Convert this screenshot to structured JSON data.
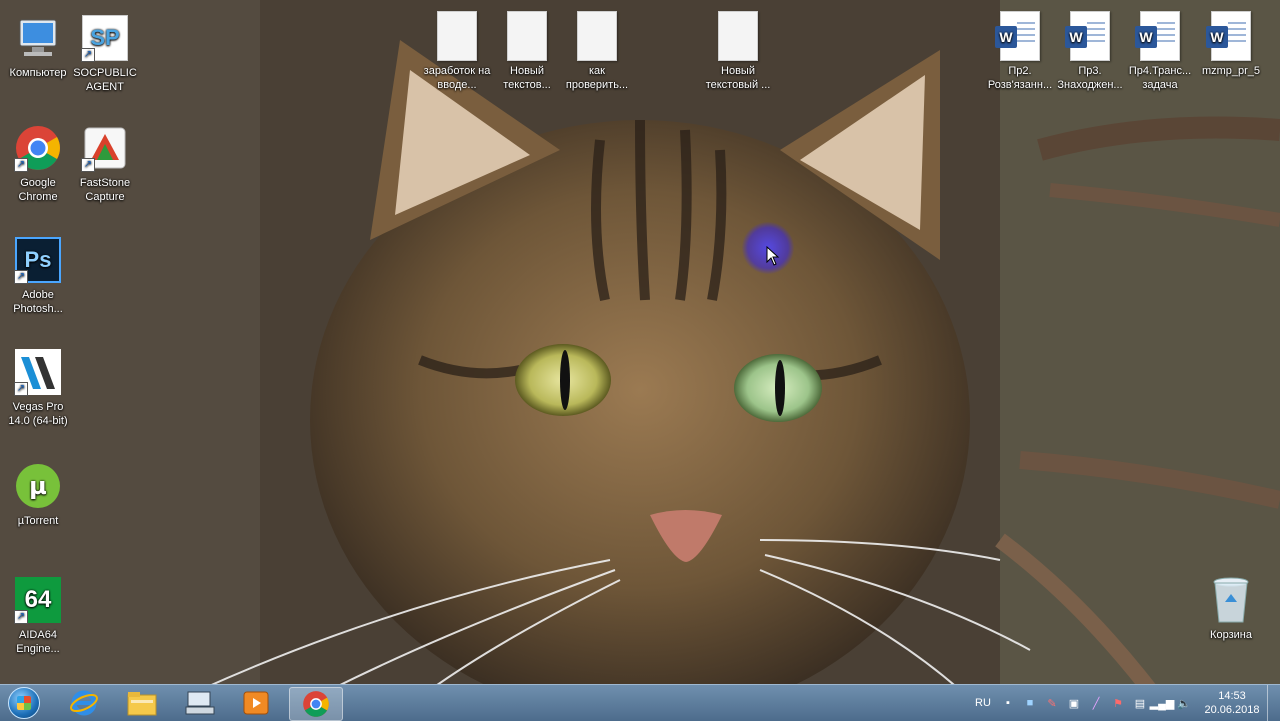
{
  "desktop": {
    "left_icons": [
      {
        "label": "Компьютер",
        "icon": "computer-icon"
      },
      {
        "label": "SOCPUBLIC AGENT",
        "icon": "socpublic-icon"
      },
      {
        "label": "Google Chrome",
        "icon": "chrome-icon"
      },
      {
        "label": "FastStone Capture",
        "icon": "faststone-icon"
      },
      {
        "label": "Adobe Photosh...",
        "icon": "photoshop-icon"
      },
      {
        "label": "Vegas Pro 14.0 (64-bit)",
        "icon": "vegas-icon"
      },
      {
        "label": "µTorrent",
        "icon": "utorrent-icon"
      },
      {
        "label": "AIDA64 Engine...",
        "icon": "aida64-icon"
      }
    ],
    "top_files": [
      {
        "label": "заработок на вводе...",
        "icon": "text-file-icon"
      },
      {
        "label": "Новый текстов...",
        "icon": "text-file-icon"
      },
      {
        "label": "как проверить...",
        "icon": "text-file-icon"
      },
      {
        "label": "Новый текстовый ...",
        "icon": "text-file-icon"
      }
    ],
    "right_files": [
      {
        "label": "Пр2. Розв'язанн...",
        "icon": "word-doc-icon"
      },
      {
        "label": "Пр3. Знаходжен...",
        "icon": "word-doc-icon"
      },
      {
        "label": "Пр4.Транс... задача",
        "icon": "word-doc-icon"
      },
      {
        "label": "mzmp_pr_5",
        "icon": "word-doc-icon"
      }
    ],
    "recycle_bin": {
      "label": "Корзина",
      "icon": "recycle-bin-icon"
    },
    "word_badge": "W",
    "ps_badge": "Ps",
    "sp_badge": "SP",
    "aida_badge": "64"
  },
  "taskbar": {
    "pinned": [
      "internet-explorer-icon",
      "explorer-folder-icon",
      "keyboard-app-icon",
      "media-player-icon",
      "chrome-icon"
    ],
    "language": "RU",
    "time": "14:53",
    "date": "20.06.2018"
  },
  "colors": {
    "taskbar": "#5a7a9a",
    "word_blue": "#2b579a",
    "chrome_red": "#db4437",
    "chrome_yellow": "#f4b400",
    "chrome_green": "#0f9d58",
    "chrome_blue": "#4285f4"
  }
}
